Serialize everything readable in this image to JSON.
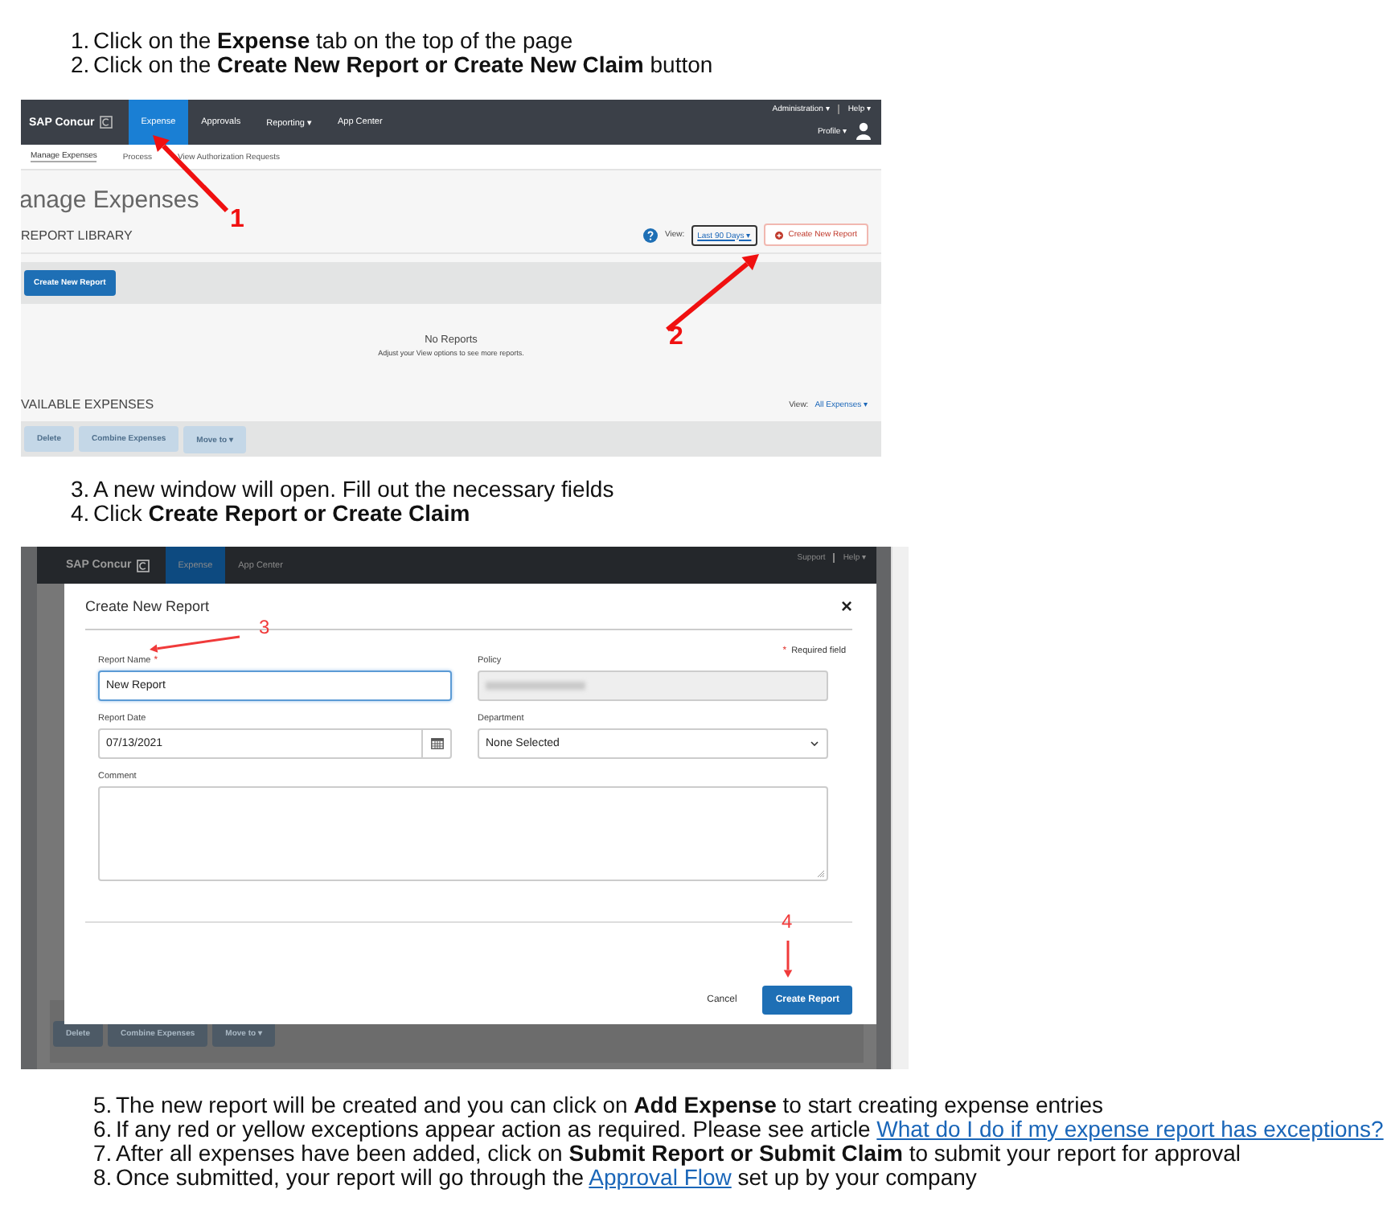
{
  "intro_steps": [
    {
      "number": "1.",
      "text": "Click on the **Expense** tab on the top of the page"
    },
    {
      "number": "2.",
      "text": "Click on the **Create New Report or Create New Claim** button"
    }
  ],
  "screenshot_1": {
    "nav": {
      "logo": "SAP Concur",
      "tabs": [
        {
          "label": "Expense",
          "selected": true
        },
        {
          "label": "Approvals",
          "selected": false
        },
        {
          "label": "Reporting ▾",
          "selected": false
        },
        {
          "label": "App Center",
          "selected": false
        }
      ],
      "top_links": [
        "Administration ▾",
        "Help ▾"
      ],
      "profile": "Profile ▾"
    },
    "subnav": [
      {
        "label": "Manage Expenses",
        "selected": true
      },
      {
        "label": "Process",
        "selected": false
      },
      {
        "label": "View Authorization Requests",
        "selected": false
      }
    ],
    "page_title": "anage Expenses",
    "report_library": {
      "heading": "REPORT LIBRARY",
      "view_label": "View:",
      "view_value": "Last 90 Days ▾",
      "create_link": "Create New Report",
      "create_button": "Create New Report",
      "empty_title": "No Reports",
      "empty_hint": "Adjust your View options to see more reports."
    },
    "available_expenses": {
      "heading": "VAILABLE EXPENSES",
      "view_label": "View:",
      "view_value": "All Expenses ▾",
      "actions": [
        {
          "label": "Delete",
          "disabled": true
        },
        {
          "label": "Combine Expenses",
          "disabled": true
        },
        {
          "label": "Move to ▾",
          "disabled": true
        }
      ]
    },
    "annotations": [
      "1",
      "2"
    ]
  },
  "middle_steps": [
    {
      "number": "3.",
      "text": "A new window will open. Fill out the necessary fields"
    },
    {
      "number": "4.",
      "text": "Click **Create Report or Create Claim**"
    }
  ],
  "screenshot_2": {
    "nav": {
      "logo": "SAP Concur",
      "tabs": [
        {
          "label": "Expense",
          "selected": true
        },
        {
          "label": "App Center",
          "selected": false
        }
      ],
      "top_links": [
        "Support",
        "Help ▾"
      ]
    },
    "background_actions": [
      "Delete",
      "Combine Expenses",
      "Move to ▾"
    ],
    "dialog": {
      "title": "Create New Report",
      "close": "×",
      "required_mark": "*",
      "required_note": "Required field",
      "fields": [
        {
          "kind": "text",
          "label": "Report Name",
          "required": true,
          "value": "New Report",
          "focused": true
        },
        {
          "kind": "readonly",
          "label": "Policy",
          "required": false
        },
        {
          "kind": "date",
          "label": "Report Date",
          "required": false,
          "value": "07/13/2021"
        },
        {
          "kind": "select",
          "label": "Department",
          "required": false,
          "value": "None Selected"
        },
        {
          "kind": "textarea",
          "label": "Comment",
          "required": false
        }
      ],
      "buttons": [
        {
          "kind": "link",
          "label": "Cancel"
        },
        {
          "kind": "primary",
          "label": "Create Report"
        }
      ]
    },
    "annotations": [
      "3",
      "4"
    ]
  },
  "final_steps": [
    {
      "number": "5.",
      "text": "The new report will be created and you can click on **Add Expense** to start creating expense entries"
    },
    {
      "number": "6.",
      "text": "If any red or yellow exceptions appear action as required. Please see article ",
      "link": "What do I do if my expense report has exceptions?"
    },
    {
      "number": "7.",
      "text": "After all expenses have been added, click on **Submit Report or Submit Claim** to submit your report for approval"
    },
    {
      "number": "8.",
      "text": "Once submitted, your report will go through the ",
      "link": "Approval Flow",
      "after": " set up by your company"
    }
  ]
}
